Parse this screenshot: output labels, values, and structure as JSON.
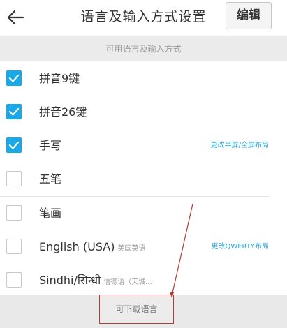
{
  "header": {
    "title": "语言及输入方式设置",
    "edit_label": "编辑",
    "back_icon": "arrow-left-icon"
  },
  "section": {
    "available_label": "可用语言及输入方式"
  },
  "items": [
    {
      "label": "拼音9键",
      "sub": "",
      "link": "",
      "checked": true
    },
    {
      "label": "拼音26键",
      "sub": "",
      "link": "",
      "checked": true
    },
    {
      "label": "手写",
      "sub": "",
      "link": "更改半屏/全屏布局",
      "checked": true
    },
    {
      "label": "五笔",
      "sub": "",
      "link": "",
      "checked": false
    },
    {
      "label": "笔画",
      "sub": "",
      "link": "",
      "checked": false
    },
    {
      "label": "English (USA)",
      "sub": "美国英语",
      "link": "更改QWERTY布局",
      "checked": false
    },
    {
      "label": "Sindhi/सिन्धी",
      "sub": "信德语（天城...",
      "link": "",
      "checked": false
    }
  ],
  "footer": {
    "download_label": "可下载语言"
  },
  "colors": {
    "accent": "#1aa9e6",
    "link": "#2aa3d6",
    "annotation": "#b13a3a"
  }
}
